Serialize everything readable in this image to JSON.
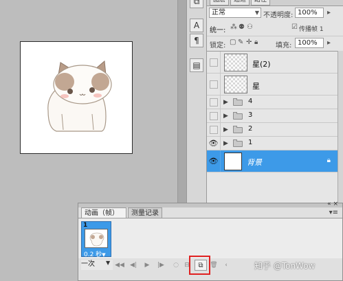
{
  "layers_panel": {
    "tabs": [
      "图层",
      "通道",
      "路径"
    ],
    "blend_mode": "正常",
    "opacity_label": "不透明度:",
    "opacity_value": "100%",
    "unify_label": "统一:",
    "propagate_label": "传播帧 1",
    "lock_label": "锁定:",
    "fill_label": "填充:",
    "fill_value": "100%",
    "layers": [
      {
        "name": "星(2)",
        "kind": "layer",
        "visible": false
      },
      {
        "name": "星",
        "kind": "layer",
        "visible": false
      },
      {
        "name": "4",
        "kind": "group",
        "visible": false
      },
      {
        "name": "3",
        "kind": "group",
        "visible": false
      },
      {
        "name": "2",
        "kind": "group",
        "visible": false
      },
      {
        "name": "1",
        "kind": "group",
        "visible": true
      },
      {
        "name": "背景",
        "kind": "background",
        "visible": true,
        "selected": true
      }
    ]
  },
  "tools_strip": {
    "icons": [
      "layers-icon",
      "text-A-icon",
      "paragraph-icon",
      "info-icon"
    ],
    "text_icon_glyph": "A",
    "para_icon_glyph": "¶"
  },
  "animation_panel": {
    "tabs": [
      "动画（帧）",
      "测量记录"
    ],
    "frame_number": "1",
    "frame_delay": "0.2 秒",
    "loop_option": "一次"
  },
  "watermark": "知乎 @TonWow",
  "colors": {
    "selection_blue": "#3d9ae8",
    "highlight_red": "#e02020",
    "workspace_gray": "#bdbdbd"
  }
}
